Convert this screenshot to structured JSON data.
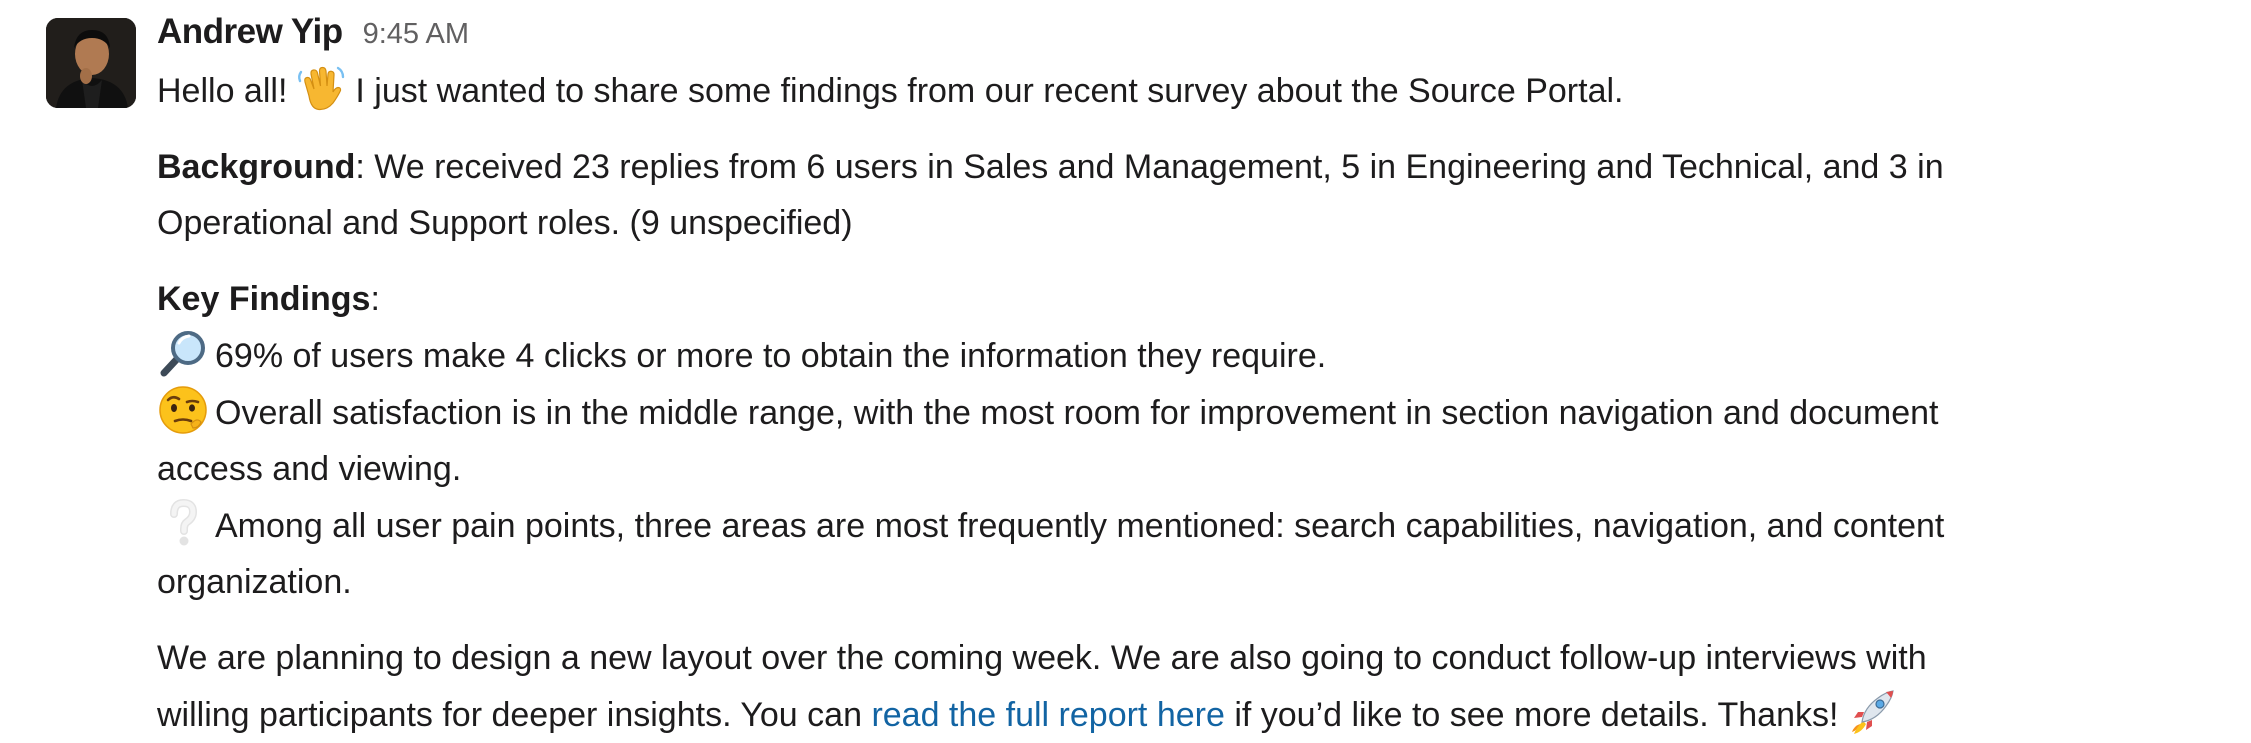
{
  "message": {
    "author": "Andrew Yip",
    "timestamp": "9:45 AM",
    "greeting": {
      "before": "Hello all!",
      "emoji": "waving-hand-icon",
      "after": "I just wanted to share some findings from our recent survey about the Source Portal."
    },
    "background": {
      "label": "Background",
      "text_line1": ": We received 23 replies from 6 users in Sales and Management, 5 in Engineering and Technical, and 3 in",
      "text_line2": "Operational and Support roles. (9 unspecified)"
    },
    "key_findings": {
      "label": "Key Findings",
      "colon": ":",
      "items": [
        {
          "emoji": "magnifying-glass-icon",
          "line1": "69% of users make 4 clicks or more to obtain the information they require."
        },
        {
          "emoji": "raised-eyebrow-face-icon",
          "line1": "Overall satisfaction is in the middle range, with the most room for improvement in section navigation and document",
          "line2": "access and viewing."
        },
        {
          "emoji": "question-mark-icon",
          "line1": "Among all user pain points, three areas are most frequently mentioned: search capabilities, navigation, and content",
          "line2": "organization."
        }
      ]
    },
    "closing": {
      "line1": "We are planning to design a new layout over the coming week. We are also going to conduct follow-up interviews with",
      "line2_before": "willing participants for deeper insights. You can ",
      "link_text": "read the full report here",
      "line2_after": " if you’d like to see more details. Thanks!",
      "emoji": "rocket-icon"
    }
  },
  "colors": {
    "text": "#1d1c1d",
    "timestamp": "#616061",
    "link": "#1264a3"
  }
}
